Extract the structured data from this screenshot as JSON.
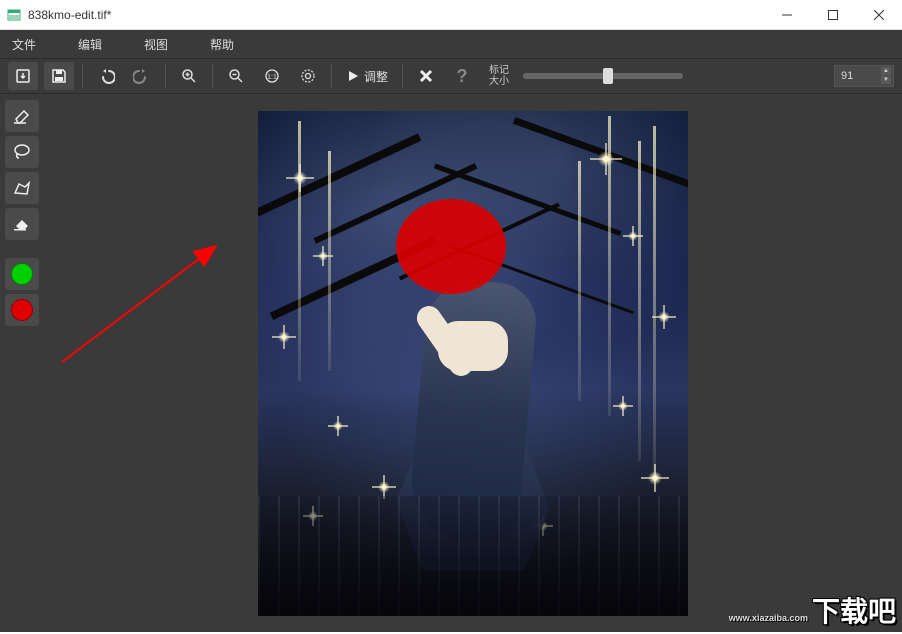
{
  "window": {
    "title": "838kmo-edit.tif*"
  },
  "menu": {
    "file": "文件",
    "edit": "编辑",
    "view": "视图",
    "help": "帮助"
  },
  "toolbar": {
    "adjust_label": "调整",
    "marker_size_line1": "标记",
    "marker_size_line2": "大小",
    "marker_value": "91"
  },
  "icons": {
    "download": "download-icon",
    "save": "save-icon",
    "undo": "undo-icon",
    "redo": "redo-icon",
    "zoom_in": "zoom-in-icon",
    "zoom_out": "zoom-out-icon",
    "zoom_actual": "zoom-actual-icon",
    "zoom_fit": "zoom-fit-icon",
    "play": "play-icon",
    "close": "close-icon",
    "help": "help-icon",
    "eraser_soft": "eraser-soft-icon",
    "lasso": "lasso-icon",
    "polygon": "polygon-icon",
    "eraser": "eraser-icon",
    "green_marker": "green-marker",
    "red_marker": "red-marker"
  },
  "colors": {
    "green": "#00d000",
    "red": "#e00000",
    "accent_red_overlay": "#d80000"
  },
  "watermark": {
    "text": "下载吧",
    "url": "www.xiazaiba.com"
  }
}
